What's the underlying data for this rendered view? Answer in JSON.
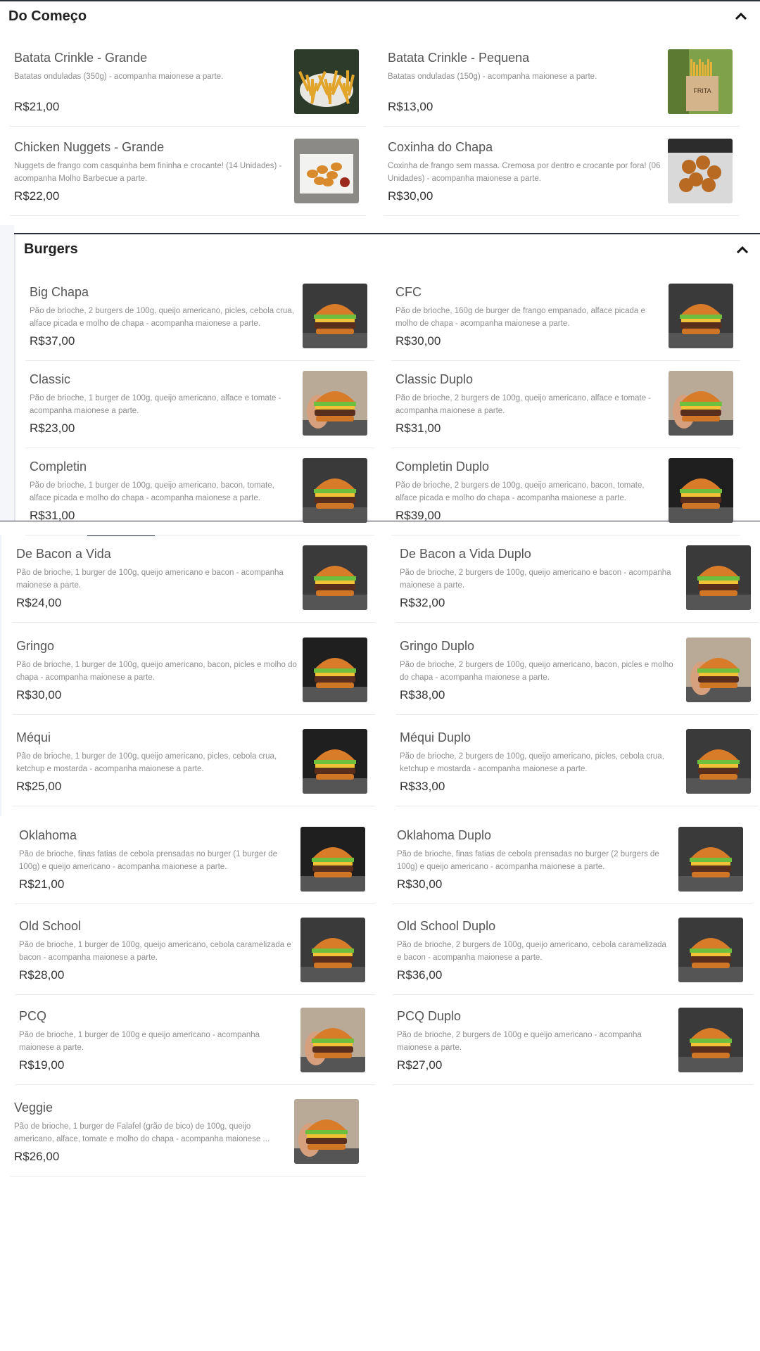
{
  "sections": {
    "do_comeco": {
      "title": "Do Começo"
    },
    "burgers": {
      "title": "Burgers"
    }
  },
  "icons": {
    "collapse": "chevron-up-icon"
  },
  "colors": {
    "section_line": "#2a2e38",
    "muted_text": "#8d8d8d",
    "price_text": "#333333"
  },
  "items": [
    {
      "name": "Batata Crinkle - Grande",
      "desc": "Batatas onduladas (350g) - acompanha maionese a parte.",
      "price": "R$21,00",
      "img": "fries"
    },
    {
      "name": "Batata Crinkle - Pequena",
      "desc": "Batatas onduladas (150g) - acompanha maionese a parte.",
      "price": "R$13,00",
      "img": "fries-box"
    },
    {
      "name": "Chicken Nuggets - Grande",
      "desc": "Nuggets de frango com casquinha bem fininha e crocante! (14 Unidades) - acompanha Molho Barbecue a parte.",
      "price": "R$22,00",
      "img": "nuggets"
    },
    {
      "name": "Coxinha do Chapa",
      "desc": "Coxinha de frango sem massa. Cremosa por dentro e crocante por fora! (06 Unidades) - acompanha maionese a parte.",
      "price": "R$30,00",
      "img": "coxinha"
    },
    {
      "name": "Big Chapa",
      "desc": "Pão de brioche, 2 burgers de 100g, queijo americano, picles, cebola crua, alface picada e molho de chapa - acompanha maionese a parte.",
      "price": "R$37,00",
      "img": "burger"
    },
    {
      "name": "CFC",
      "desc": "Pão de brioche, 160g de burger de frango empanado, alface picada e molho de chapa - acompanha maionese a parte.",
      "price": "R$30,00",
      "img": "burger"
    },
    {
      "name": "Classic",
      "desc": "Pão de brioche, 1 burger de 100g, queijo americano, alface e tomate - acompanha maionese a parte.",
      "price": "R$23,00",
      "img": "burger-hand"
    },
    {
      "name": "Classic Duplo",
      "desc": "Pão de brioche, 2 burgers de 100g, queijo americano, alface e tomate - acompanha maionese a parte.",
      "price": "R$31,00",
      "img": "burger-hand"
    },
    {
      "name": "Completin",
      "desc": "Pão de brioche, 1 burger de 100g, queijo americano, bacon, tomate, alface picada e molho do chapa - acompanha maionese a parte.",
      "price": "R$31,00",
      "img": "burger"
    },
    {
      "name": "Completin Duplo",
      "desc": "Pão de brioche, 2 burgers de 100g, queijo americano, bacon, tomate, alface picada e molho do chapa - acompanha maionese a parte.",
      "price": "R$39,00",
      "img": "burger-dark"
    },
    {
      "name": "De Bacon a Vida",
      "desc": "Pão de brioche, 1 burger de 100g, queijo americano e bacon - acompanha maionese a parte.",
      "price": "R$24,00",
      "img": "burger"
    },
    {
      "name": "De Bacon a Vida Duplo",
      "desc": "Pão de brioche, 2 burgers de 100g, queijo americano e bacon - acompanha maionese a parte.",
      "price": "R$32,00",
      "img": "burger"
    },
    {
      "name": "Gringo",
      "desc": "Pão de brioche, 1 burger de 100g, queijo americano, bacon, picles e molho do chapa - acompanha maionese a parte.",
      "price": "R$30,00",
      "img": "burger-dark"
    },
    {
      "name": "Gringo Duplo",
      "desc": "Pão de brioche, 2 burgers de 100g, queijo americano, bacon, picles e molho do chapa - acompanha maionese a parte.",
      "price": "R$38,00",
      "img": "burger-hand"
    },
    {
      "name": "Méqui",
      "desc": "Pão de brioche, 1 burger de 100g, queijo americano, picles, cebola crua, ketchup e mostarda - acompanha maionese a parte.",
      "price": "R$25,00",
      "img": "burger-dark"
    },
    {
      "name": "Méqui Duplo",
      "desc": "Pão de brioche, 2 burgers de 100g, queijo americano, picles, cebola crua, ketchup e mostarda - acompanha maionese a parte.",
      "price": "R$33,00",
      "img": "burger"
    },
    {
      "name": "Oklahoma",
      "desc": "Pão de brioche, finas fatias de cebola prensadas no burger (1 burger de 100g) e queijo americano - acompanha maionese a parte.",
      "price": "R$21,00",
      "img": "burger-dark"
    },
    {
      "name": "Oklahoma Duplo",
      "desc": "Pão de brioche, finas fatias de cebola prensadas no burger (2 burgers de 100g) e queijo americano - acompanha maionese a parte.",
      "price": "R$30,00",
      "img": "burger"
    },
    {
      "name": "Old School",
      "desc": "Pão de brioche, 1 burger de 100g, queijo americano, cebola caramelizada e bacon - acompanha maionese a parte.",
      "price": "R$28,00",
      "img": "burger"
    },
    {
      "name": "Old School Duplo",
      "desc": "Pão de brioche, 2 burgers de 100g, queijo americano, cebola caramelizada e bacon - acompanha maionese a parte.",
      "price": "R$36,00",
      "img": "burger"
    },
    {
      "name": "PCQ",
      "desc": "Pão de brioche, 1 burger de 100g e queijo americano - acompanha maionese a parte.",
      "price": "R$19,00",
      "img": "burger-hand"
    },
    {
      "name": "PCQ Duplo",
      "desc": "Pão de brioche, 2 burgers de 100g e queijo americano - acompanha maionese a parte.",
      "price": "R$27,00",
      "img": "burger"
    },
    {
      "name": "Veggie",
      "desc": "Pão de brioche, 1 burger de Falafel (grão de bico) de 100g, queijo americano, alface, tomate e molho do chapa - acompanha maionese ...",
      "price": "R$26,00",
      "img": "burger-hand"
    }
  ]
}
